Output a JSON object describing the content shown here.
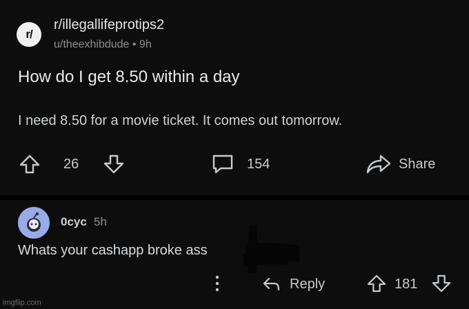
{
  "post": {
    "subreddit_icon_text": "r/",
    "subreddit": "r/illegallifeprotips2",
    "meta": "u/theexhibdude • 9h",
    "title": "How do I get 8.50 within a day",
    "body": "I need 8.50 for a movie ticket.  It comes out tomorrow.",
    "score": "26",
    "comments": "154",
    "share_label": "Share"
  },
  "comment": {
    "user": "0cyc",
    "time": "5h",
    "text": "Whats your cashapp broke ass",
    "reply_label": "Reply",
    "score": "181"
  },
  "watermark": "imgflip.com",
  "colors": {
    "background": "#0d0d0e",
    "avatar": "#9aa9e8"
  },
  "icons": [
    "upvote-icon",
    "downvote-icon",
    "comment-icon",
    "share-icon",
    "more-icon",
    "reply-icon"
  ]
}
